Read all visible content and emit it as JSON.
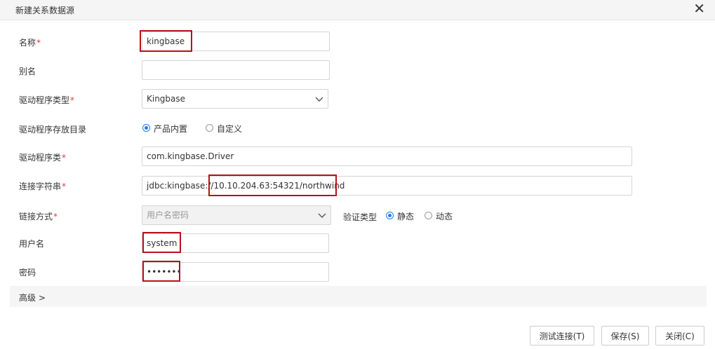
{
  "dialog": {
    "title": "新建关系数据源",
    "close_icon": "close-icon"
  },
  "form": {
    "name": {
      "label": "名称",
      "value": "kingbase"
    },
    "alias": {
      "label": "别名",
      "value": ""
    },
    "driver_type": {
      "label": "驱动程序类型",
      "value": "Kingbase"
    },
    "driver_dir": {
      "label": "驱动程序存放目录",
      "options": [
        "产品内置",
        "自定义"
      ],
      "selected": "产品内置"
    },
    "driver_class": {
      "label": "驱动程序类",
      "value": "com.kingbase.Driver"
    },
    "conn_string": {
      "label": "连接字符串",
      "value": "jdbc:kingbase://10.10.204.63:54321/northwind"
    },
    "link_mode": {
      "label": "链接方式",
      "value": "用户名密码"
    },
    "auth_type": {
      "label": "验证类型",
      "options": [
        "静态",
        "动态"
      ],
      "selected": "静态"
    },
    "username": {
      "label": "用户名",
      "value": "system"
    },
    "password": {
      "label": "密码",
      "value": "•••••••"
    },
    "required_mark": "*"
  },
  "advanced": {
    "label": "高级 >"
  },
  "buttons": {
    "test": "测试连接(T)",
    "save": "保存(S)",
    "close": "关闭(C)"
  },
  "colors": {
    "accent": "#1e7fe0",
    "highlight": "#b3121c",
    "required": "#e53935"
  }
}
